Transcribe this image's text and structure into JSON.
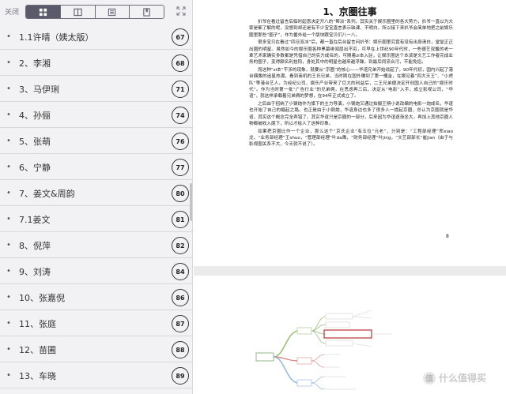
{
  "toolbar": {
    "close_label": "关闭",
    "tabs": [
      {
        "icon": "grid-icon",
        "active": true
      },
      {
        "icon": "book-icon",
        "active": false
      },
      {
        "icon": "list-icon",
        "active": false
      },
      {
        "icon": "bookmark-icon",
        "active": false
      }
    ],
    "expand_icon": "expand-icon"
  },
  "toc": {
    "items": [
      {
        "title": "1.1许晴（姨太版）",
        "page": "67"
      },
      {
        "title": "2、李湘",
        "page": "68"
      },
      {
        "title": "3、马伊琍",
        "page": "71"
      },
      {
        "title": "4、孙俪",
        "page": "74"
      },
      {
        "title": "5、张萌",
        "page": "76"
      },
      {
        "title": "6、宁静",
        "page": "77"
      },
      {
        "title": "7、姜文&周韵",
        "page": "80"
      },
      {
        "title": "7.1姜文",
        "page": "81"
      },
      {
        "title": "8、倪萍",
        "page": "82"
      },
      {
        "title": "9、刘涛",
        "page": "84"
      },
      {
        "title": "10、张嘉倪",
        "page": "86"
      },
      {
        "title": "11、张庭",
        "page": "87"
      },
      {
        "title": "12、苗圃",
        "page": "88"
      },
      {
        "title": "13、车晓",
        "page": "89"
      }
    ]
  },
  "document": {
    "title": "1、京圈往事",
    "paragraphs": [
      "扒爷在看过留言后临时起意决定开八的“帮派”系列。其实关于娱乐圈里的各大势力，扒爷一直以为大家是都了解的呢，没想到却还是有不少宝宝直言表示缺课、不明白。所以接下来扒爷会简单地把之前娱乐圈里那些“圈子”，作为番外给一个版块跟宝贝们八一八。",
      "很多宝贝在看过“四旦双冰”后，都一直在后台留言问扒爷：娱乐圈里究竟有没有出身清白，堂堂正正出圈的明星。虽然如今的娱乐圈各种黑幕绯闻层出不穷，可早在上世纪90年代时，一些德艺双馨的老一辈艺术家确实多数都是凭借自己的实力成名的，可随着zi本入驻，让娱乐圈这个本该是文艺工作者完成业务的圈子，变得颇名利挂钩，身处其中的明星也越来越浮躁，到最后同流合污，不能免俗。",
      "而这种“zi本”干涉的现象，就要从“京圈”的核心——华谊兄弟开始说起了。90年代初，国内兴起了港台偶像的追星热潮，看到商机的王氏兄弟，当时刚在国外赚到了第一桶金，在眼见着“四大天王”、“小虎队”等港台艺人，为经纪公司、娱乐产业带来了巨大的利益后，二王兄弟便决定开创国人自己的“娱乐时代”。作为当时第一批“广告行业”的兄弟俩，在思虑再三后，决定从“电影”入手，成立影视公司，“华谊”，就这样承载着兄弟俩的梦想，在94年正式成立了。",
      "之后由于招纳了小钢炮作为旗下的主力导演，小钢炮又通过拍摄王朔小说改编的电影一炮成名，华谊也开始了自己的崛起之路。也正是由于小钢炮，华谊身边也多了很多人一提起京圈，总认为京圈就是华谊，其实这个概念完全弄错了。其实华谊只是京圈的一部分，后来因为华谊逐渐坐大，再加上其他京圈人物都被收入麾下，所以才给人了这种印象。",
      "如果把京圈比作一个企业，那么这个“京氏企业”有五位“元老”，分别是：“工程部经理”郑xiao龙，“业务部经理”王shuo，“管理部经理”叶da鹰，“财务部经理”叶jing，“文艺部部长”崔jian（由于与影视圈关系不大，今天就不说了）。"
    ],
    "page_number": "8"
  },
  "watermark": {
    "text": "什么值得买",
    "badge": "值"
  }
}
